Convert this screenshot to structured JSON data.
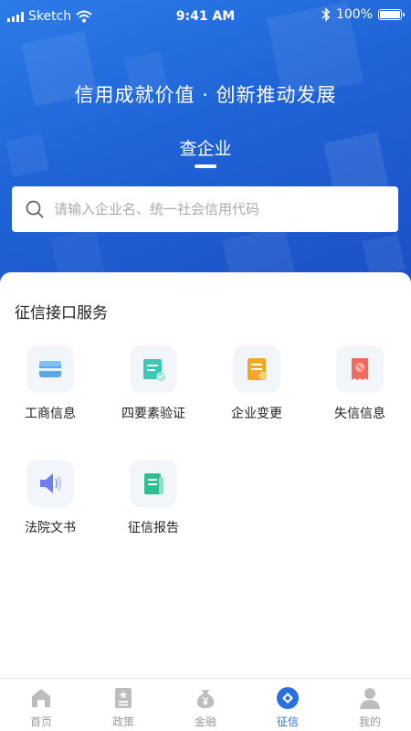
{
  "status_bar": {
    "carrier": "Sketch",
    "time": "9:41 AM",
    "battery": "100%"
  },
  "hero": {
    "slogan": "信用成就价值 · 创新推动发展",
    "active_tab": "查企业"
  },
  "search": {
    "placeholder": "请输入企业名、统一社会信用代码"
  },
  "section": {
    "title": "征信接口服务"
  },
  "services": [
    {
      "label": "工商信息",
      "icon": "business-info-icon"
    },
    {
      "label": "四要素验证",
      "icon": "four-factor-verify-icon"
    },
    {
      "label": "企业变更",
      "icon": "enterprise-change-icon"
    },
    {
      "label": "失信信息",
      "icon": "dishonesty-info-icon"
    },
    {
      "label": "法院文书",
      "icon": "court-document-icon"
    },
    {
      "label": "征信报告",
      "icon": "credit-report-icon"
    }
  ],
  "tabs": [
    {
      "label": "首页",
      "icon": "home-icon",
      "active": false
    },
    {
      "label": "政策",
      "icon": "policy-icon",
      "active": false
    },
    {
      "label": "金融",
      "icon": "finance-icon",
      "active": false
    },
    {
      "label": "征信",
      "icon": "credit-icon",
      "active": true
    },
    {
      "label": "我的",
      "icon": "profile-icon",
      "active": false
    }
  ],
  "colors": {
    "brand_blue": "#2a6fe0",
    "tab_inactive": "#999999"
  }
}
